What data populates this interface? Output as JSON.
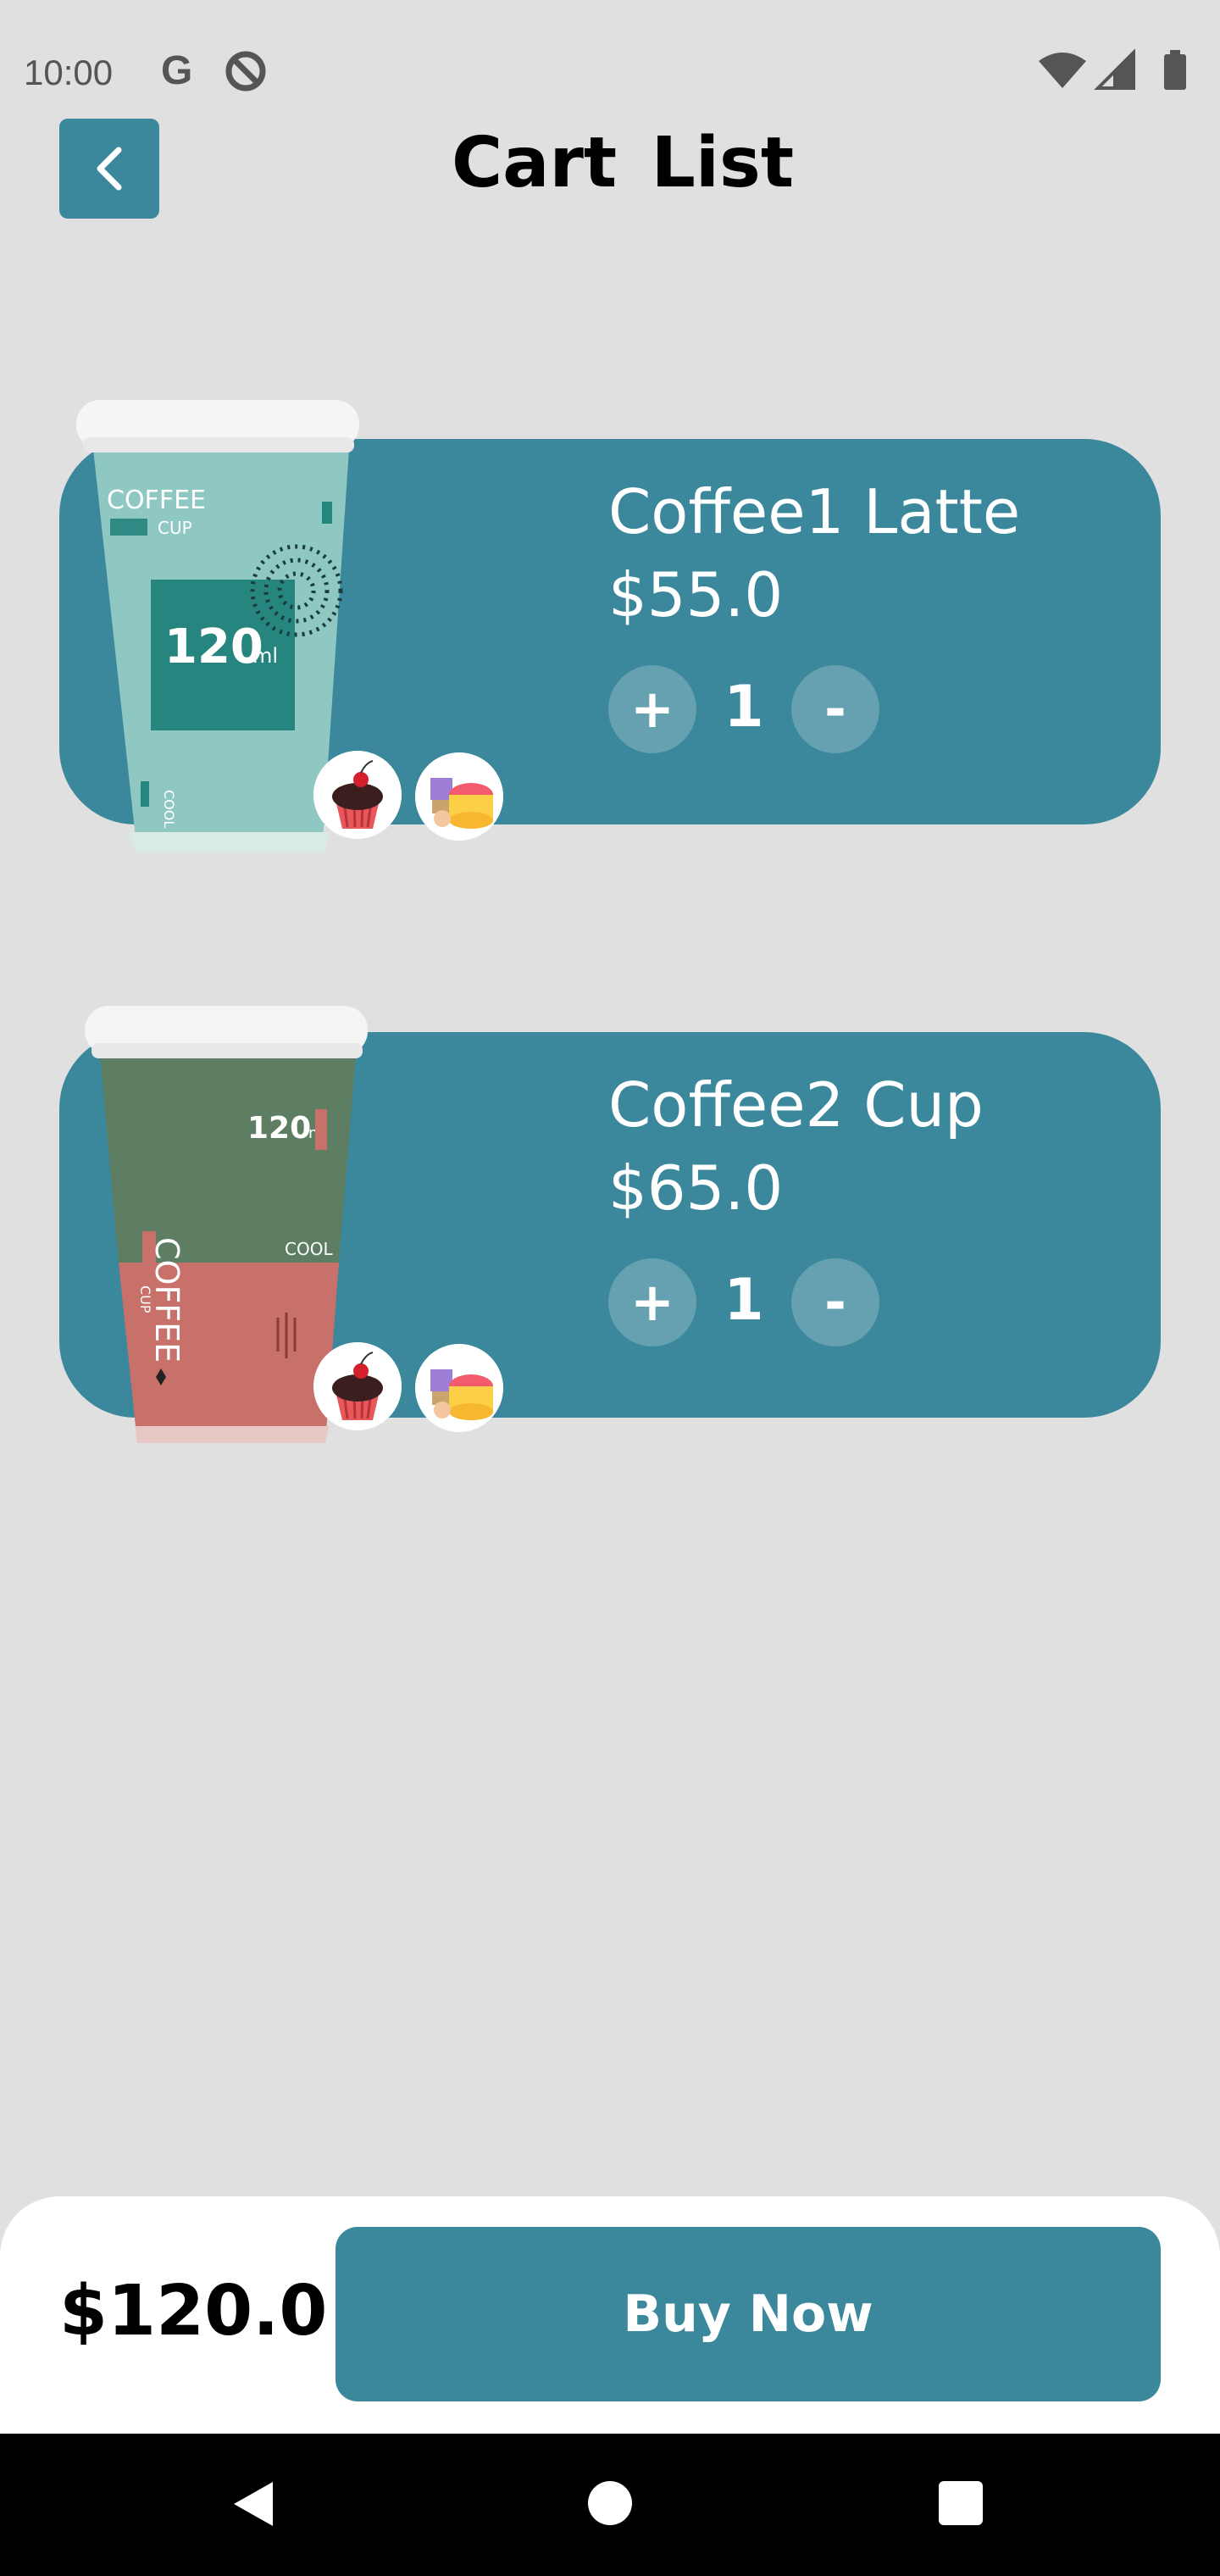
{
  "status_bar": {
    "time": "10:00",
    "g_label": "G"
  },
  "header": {
    "title": "Cart  List"
  },
  "cart": {
    "items": [
      {
        "name": "Coffee1 Latte",
        "price": "$55.0",
        "quantity": "1",
        "plus_label": "+",
        "minus_label": "-",
        "cup_volume": "120",
        "cup_unit": "ml",
        "cup_brand": "COFFEE",
        "cup_sub": "CUP",
        "cup_side": "COOL"
      },
      {
        "name": "Coffee2 Cup",
        "price": "$65.0",
        "quantity": "1",
        "plus_label": "+",
        "minus_label": "-",
        "cup_volume": "120",
        "cup_unit": "ml",
        "cup_brand": "COFFEE",
        "cup_sub": "CUP",
        "cup_side": "COOL"
      }
    ]
  },
  "footer": {
    "total": "$120.0",
    "buy_label": "Buy Now"
  },
  "colors": {
    "accent": "#3b879b",
    "background": "#e0e0e0",
    "cup1": "#8fc8c2",
    "cup2_top": "#5e7e64",
    "cup2_bottom": "#c8706a"
  },
  "icons": [
    "back-arrow-icon",
    "wifi-icon",
    "signal-icon",
    "battery-icon",
    "nav-back-icon",
    "nav-home-icon",
    "nav-recent-icon",
    "cupcake-icon",
    "cakes-icon"
  ]
}
